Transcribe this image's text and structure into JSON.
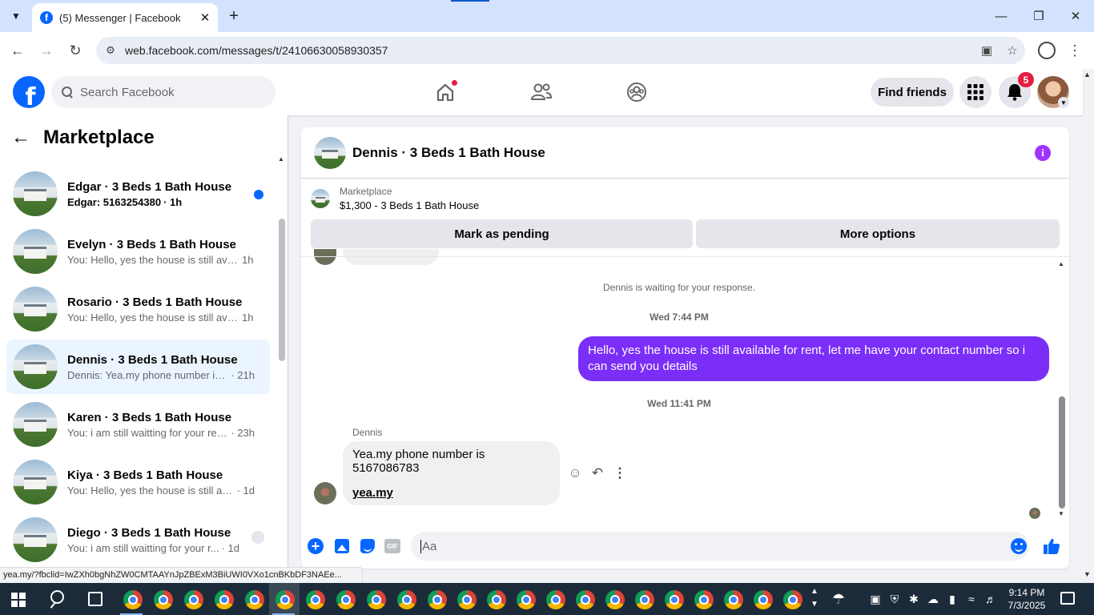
{
  "browser": {
    "tab_title": "(5) Messenger | Facebook",
    "tab_favicon": "f",
    "url": "web.facebook.com/messages/t/24106630058930357",
    "status_url": "yea.my/?fbclid=IwZXh0bgNhZW0CMTAAYnJpZBExM3BiUWI0VXo1cnBKbDF3NAEe..."
  },
  "fb_header": {
    "search_placeholder": "Search Facebook",
    "find_friends_label": "Find friends",
    "notification_count": "5",
    "brand_color": "#0866ff"
  },
  "sidebar": {
    "title": "Marketplace",
    "conversations": [
      {
        "name": "Edgar · 3 Beds 1 Bath House",
        "snippet": "Edgar: 5163254380",
        "time": "· 1h",
        "unread": true
      },
      {
        "name": "Evelyn · 3 Beds 1 Bath House",
        "snippet": "You: Hello, yes the house is still avai...",
        "time": "1h"
      },
      {
        "name": "Rosario · 3 Beds 1 Bath House",
        "snippet": "You: Hello, yes the house is still avai...",
        "time": "1h"
      },
      {
        "name": "Dennis · 3 Beds 1 Bath House",
        "snippet": "Dennis: Yea.my phone number is ...",
        "time": "· 21h",
        "active": true
      },
      {
        "name": "Karen · 3 Beds 1 Bath House",
        "snippet": "You: i am still waitting for your res...",
        "time": "· 23h"
      },
      {
        "name": "Kiya · 3 Beds 1 Bath House",
        "snippet": "You: Hello, yes the house is still ava...",
        "time": "· 1d"
      },
      {
        "name": "Diego · 3 Beds 1 Bath House",
        "snippet": "You: i am still waitting for your r...",
        "time": "· 1d"
      }
    ]
  },
  "chat": {
    "title": "Dennis · 3 Beds 1 Bath House",
    "listing_label": "Marketplace",
    "listing_price": "$1,300 - 3 Beds 1 Bath House",
    "mark_pending_label": "Mark as pending",
    "more_options_label": "More options",
    "waiting_note": "Dennis is waiting for your response.",
    "time_1": "Wed 7:44 PM",
    "sent_message": "Hello, yes the house is still available for rent, let me have your contact number so i can send you  details",
    "time_2": "Wed 11:41 PM",
    "sender_name": "Dennis",
    "received_line_1": "Yea.my phone number is 5167086783",
    "received_link": "yea.my",
    "composer_placeholder": "Aa",
    "gif_label": "GIF",
    "accent_color": "#7a2ef7"
  },
  "taskbar": {
    "time": "9:14 PM",
    "date": "7/3/2025"
  }
}
